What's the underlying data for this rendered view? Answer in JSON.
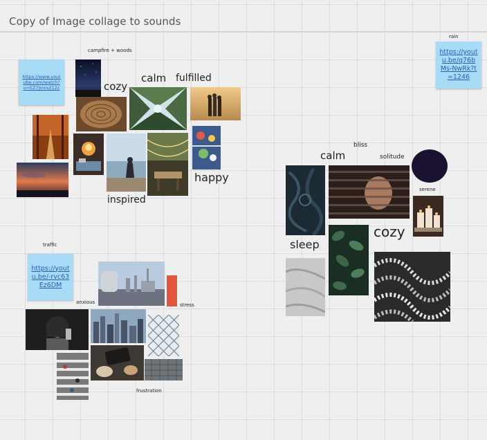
{
  "board": {
    "title": "Copy of Image collage to sounds"
  },
  "stickies": {
    "campfire_link": "https://www.youtube.com/watch?v=EZ7Jmnut12c",
    "rain_link": "https://youtu.be/q76bMs-NwRk?t=1246",
    "traffic_link": "https://youtu.be/-rvc63Ez6DM"
  },
  "labels": {
    "campfire_woods": "campfire + woods",
    "rain": "rain",
    "traffic": "traffic",
    "anxious": "anxious",
    "stress": "stress",
    "frustration": "frustration",
    "bliss": "bliss",
    "solitude": "solitude",
    "serene": "serene",
    "cozy_1": "cozy",
    "calm_1": "calm",
    "fulfilled": "fulfilled",
    "happy": "happy",
    "inspired": "inspired",
    "calm_2": "calm",
    "sleep": "sleep",
    "cozy_2": "cozy"
  },
  "colors": {
    "sticky": "#a8dbf5",
    "accent_orange": "#e2573a",
    "dark_circle": "#1a1230"
  },
  "images": {
    "campfire": [
      "night-sky-photo",
      "tree-rings-photo",
      "forest-canopy-photo",
      "friends-sunset-photo",
      "autumn-path-photo",
      "campfire-food-photo",
      "lake-person-photo",
      "fairy-lights-patio-photo",
      "picnic-photo",
      "sunset-clouds-photo"
    ],
    "rain": [
      "swirl-texture-photo",
      "window-blinds-photo",
      "dark-circle-shape",
      "candles-photo",
      "leaves-photo",
      "bedsheets-photo",
      "wave-pattern-photo"
    ],
    "traffic": [
      "industrial-plant-photo",
      "orange-block-shape",
      "woman-portrait-photo",
      "city-skyline-photo",
      "chain-fence-photo",
      "crosswalk-photo",
      "desk-phone-photo",
      "grey-blocks-photo"
    ]
  }
}
